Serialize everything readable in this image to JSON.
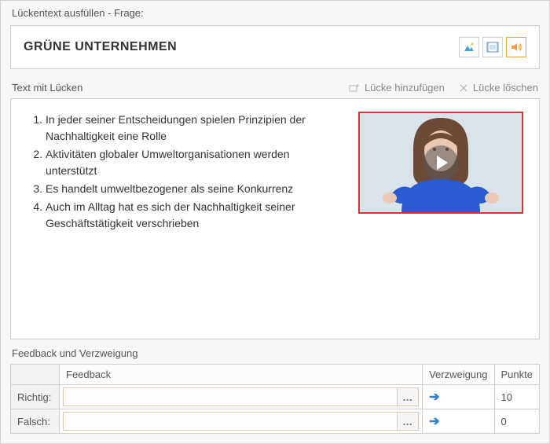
{
  "headerLabel": "Lückentext ausfüllen - Frage:",
  "questionTitle": "GRÜNE UNTERNEHMEN",
  "textSectionLabel": "Text mit Lücken",
  "addGapLabel": "Lücke hinzufügen",
  "deleteGapLabel": "Lücke löschen",
  "listItems": {
    "i1": "In jeder seiner Entscheidungen spielen Prinzipien der Nachhaltigkeit eine Rolle",
    "i2": "Aktivitäten globaler Umweltorganisationen werden unterstützt",
    "i3": "Es handelt umweltbezogener als seine Konkurrenz",
    "i4": "Auch im Alltag hat es sich der Nachhaltigkeit seiner Geschäftstätigkeit verschrieben"
  },
  "feedbackHeader": "Feedback und Verzweigung",
  "tableHeaders": {
    "feedback": "Feedback",
    "branch": "Verzweigung",
    "points": "Punkte"
  },
  "rows": {
    "correct": {
      "label": "Richtig:",
      "feedback": "",
      "branch": "➔",
      "points": "10"
    },
    "wrong": {
      "label": "Falsch:",
      "feedback": "",
      "branch": "➔",
      "points": "0"
    }
  },
  "moreLabel": "…"
}
